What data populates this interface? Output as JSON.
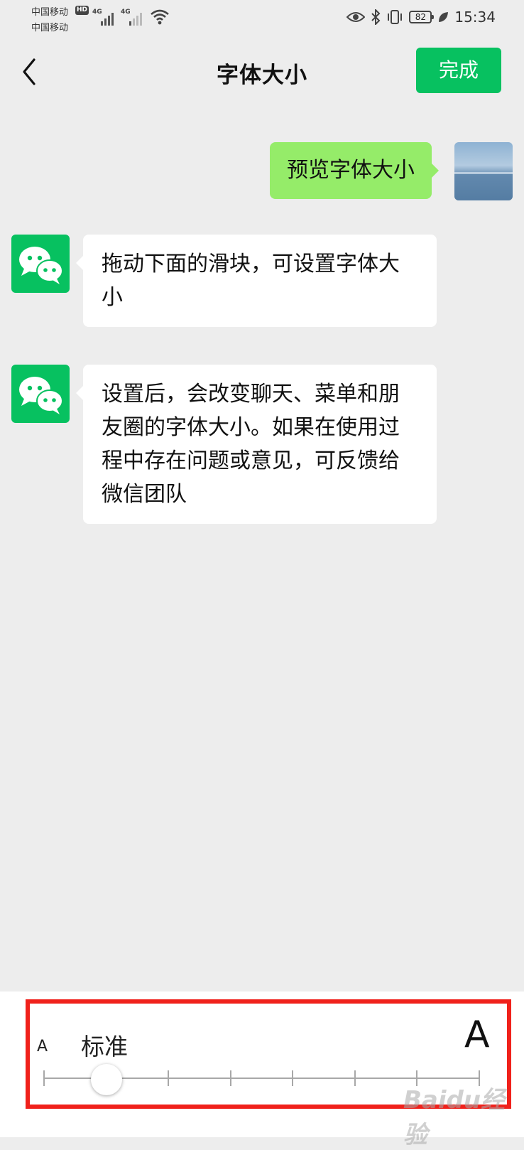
{
  "status_bar": {
    "carrier1": "中国移动",
    "carrier2": "中国移动",
    "hd_badge": "HD",
    "network1": "4G",
    "network2": "4G",
    "battery": "82",
    "time": "15:34"
  },
  "nav": {
    "title": "字体大小",
    "done_label": "完成"
  },
  "chat": {
    "outgoing": "预览字体大小",
    "incoming1": "拖动下面的滑块，可设置字体大小",
    "incoming2": "设置后，会改变聊天、菜单和朋友圈的字体大小。如果在使用过程中存在问题或意见，可反馈给微信团队"
  },
  "font_slider": {
    "small_label": "A",
    "large_label": "A",
    "current_level_label": "标准",
    "position": 1,
    "steps": 8
  },
  "watermark": "Baidu经验",
  "colors": {
    "accent": "#07c160",
    "bubble_out": "#95ec69",
    "highlight": "#f0211b"
  }
}
